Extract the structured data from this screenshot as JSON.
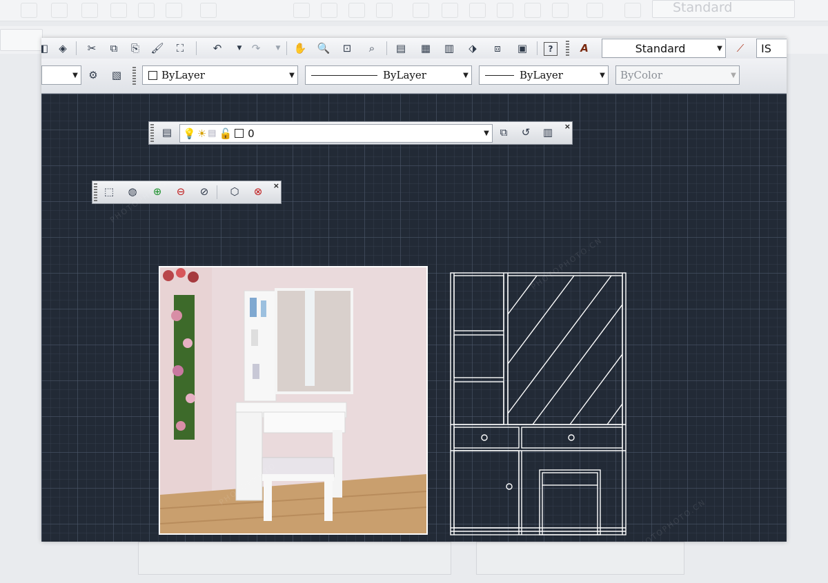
{
  "ghost": {
    "style_label": "Standard"
  },
  "toolbar": {
    "text_style": "Standard",
    "dim_style_partial": "IS"
  },
  "properties": {
    "color": "ByLayer",
    "linetype": "ByLayer",
    "lineweight": "ByLayer",
    "plotstyle": "ByColor"
  },
  "layers": {
    "current_layer": "0"
  },
  "watermark": {
    "domain": "PHOTOPHOTO.CN",
    "brand": "PHOTOPHOTO"
  },
  "colors": {
    "canvas": "#222a36",
    "cad_line": "#ffffff",
    "toolbar": "#e6e8ec"
  }
}
